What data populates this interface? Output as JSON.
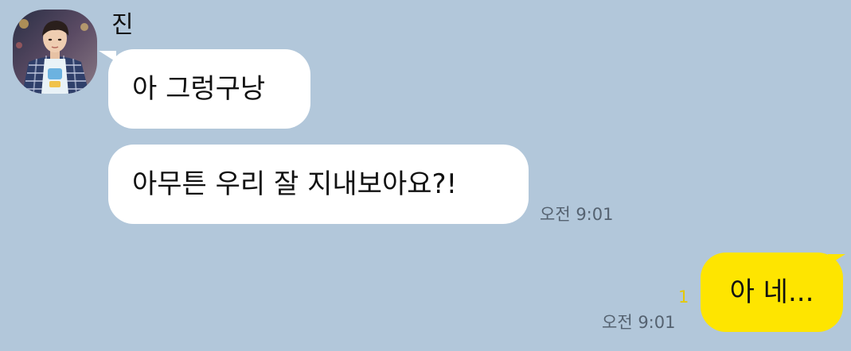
{
  "sender": {
    "name": "진"
  },
  "messages": [
    {
      "from": "other",
      "text": "아 그렁구낭"
    },
    {
      "from": "other",
      "text": "아무튼 우리 잘 지내보아요?!",
      "time": "오전 9:01"
    },
    {
      "from": "me",
      "text": "아 네...",
      "time": "오전 9:01",
      "unread_count": "1"
    }
  ],
  "colors": {
    "background": "#b2c7da",
    "received_bubble": "#ffffff",
    "sent_bubble": "#fee500",
    "unread_indicator": "#e6c900"
  },
  "icons": {
    "avatar": "profile-photo"
  }
}
